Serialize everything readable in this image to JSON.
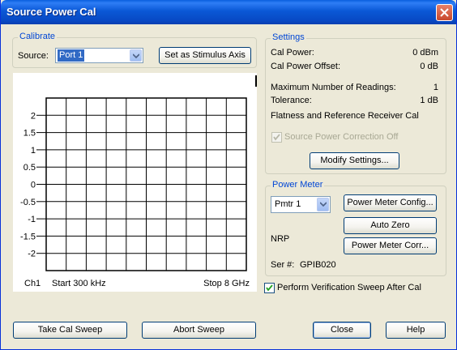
{
  "window": {
    "title": "Source Power Cal"
  },
  "calibrate": {
    "group_title": "Calibrate",
    "source_label": "Source:",
    "source_value": "Port 1",
    "stimulus_button": "Set as Stimulus Axis"
  },
  "chart": {
    "channel": "Ch1",
    "start": "Start 300 kHz",
    "stop": "Stop 8 GHz"
  },
  "chart_data": {
    "type": "line",
    "title": "",
    "xlabel": "",
    "ylabel": "",
    "yticks": [
      "2",
      "1.5",
      "1",
      "0.5",
      "0",
      "-0.5",
      "-1",
      "-1.5",
      "-2"
    ],
    "ylim": [
      -2.5,
      2.5
    ],
    "x_divisions": 10,
    "y_divisions": 10,
    "grid": true,
    "series": []
  },
  "settings": {
    "group_title": "Settings",
    "cal_power_label": "Cal Power:",
    "cal_power_value": "0 dBm",
    "offset_label": "Cal Power Offset:",
    "offset_value": "0 dB",
    "readings_label": "Maximum Number of Readings:",
    "readings_value": "1",
    "tolerance_label": "Tolerance:",
    "tolerance_value": "1 dB",
    "flatness_text": "Flatness and Reference Receiver Cal",
    "correction_off_label": "Source Power Correction Off",
    "correction_off_checked": true,
    "modify_button": "Modify Settings..."
  },
  "power_meter": {
    "group_title": "Power Meter",
    "meter_value": "Pmtr 1",
    "config_button": "Power Meter Config...",
    "auto_zero_button": "Auto Zero",
    "model": "NRP",
    "corr_button": "Power Meter Corr...",
    "serial_label": "Ser #:",
    "serial_value": "GPIB020"
  },
  "verification": {
    "label": "Perform Verification Sweep After Cal",
    "checked": true
  },
  "footer": {
    "take_cal_button": "Take Cal Sweep",
    "abort_button": "Abort Sweep",
    "close_button": "Close",
    "help_button": "Help"
  },
  "colors": {
    "titlebar": "#0a58d6",
    "group_title": "#0046d5",
    "dialog_bg": "#ece9d8",
    "close_button": "#d65133"
  }
}
